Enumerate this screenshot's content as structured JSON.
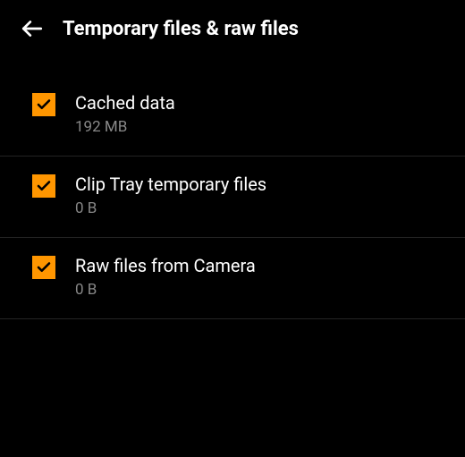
{
  "header": {
    "title": "Temporary files & raw files"
  },
  "items": [
    {
      "label": "Cached data",
      "size": "192 MB",
      "checked": true
    },
    {
      "label": "Clip Tray temporary files",
      "size": "0 B",
      "checked": true
    },
    {
      "label": "Raw files from Camera",
      "size": "0 B",
      "checked": true
    }
  ],
  "colors": {
    "accent": "#ff9600",
    "background": "#000000",
    "text_primary": "#ffffff",
    "text_secondary": "#888888"
  }
}
